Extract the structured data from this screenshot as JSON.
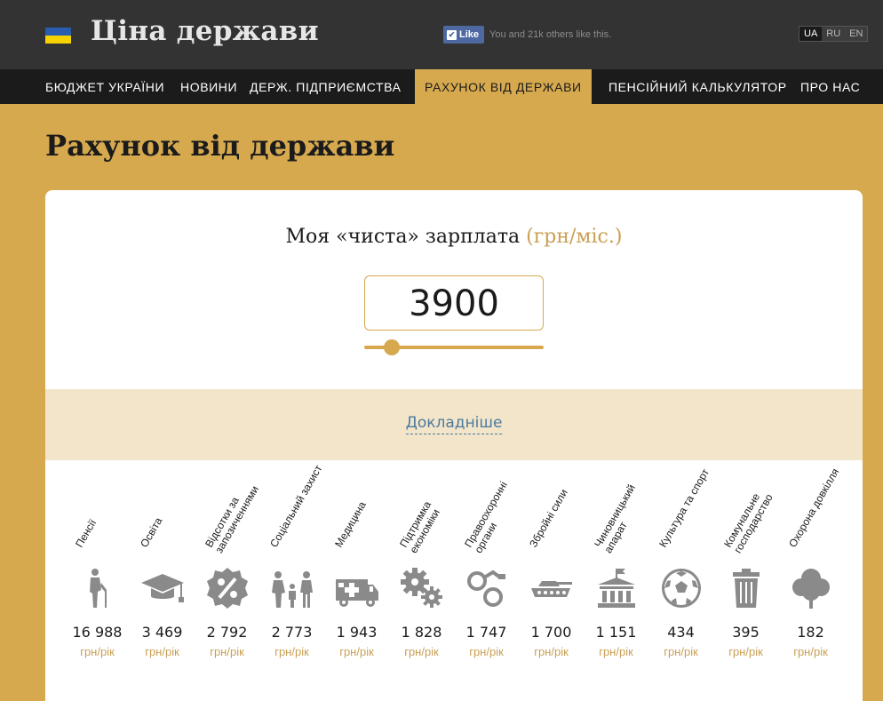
{
  "header": {
    "site_title": "Ціна держави",
    "fb_like": "Like",
    "fb_text": "You and 21k others like this.",
    "languages": [
      "UA",
      "RU",
      "EN"
    ],
    "active_language": "UA"
  },
  "nav": {
    "items": [
      {
        "label": "БЮДЖЕТ УКРАЇНИ"
      },
      {
        "label": "НОВИНИ"
      },
      {
        "label": "ДЕРЖ. ПІДПРИЄМСТВА"
      },
      {
        "label": "РАХУНОК ВІД ДЕРЖАВИ"
      },
      {
        "label": "ПЕНСІЙНИЙ КАЛЬКУЛЯТОР"
      },
      {
        "label": "ПРО НАС"
      }
    ],
    "active": "РАХУНОК ВІД ДЕРЖАВИ"
  },
  "page": {
    "title": "Рахунок від держави"
  },
  "calculator": {
    "label": "Моя «чиста» зарплата",
    "unit": "(грн/міс.)",
    "salary_value": "3900",
    "slider_fraction": 0.12,
    "details_link": "Докладніше"
  },
  "categories": [
    {
      "label": "Пенсії",
      "icon": "pensioner-icon",
      "value": "16 988",
      "unit": "грн/рік"
    },
    {
      "label": "Освіта",
      "icon": "graduation-cap-icon",
      "value": "3 469",
      "unit": "грн/рік"
    },
    {
      "label": "Відсотки за запозиченнями",
      "icon": "percent-badge-icon",
      "value": "2 792",
      "unit": "грн/рік"
    },
    {
      "label": "Соціальний захист",
      "icon": "family-icon",
      "value": "2 773",
      "unit": "грн/рік"
    },
    {
      "label": "Медицина",
      "icon": "ambulance-icon",
      "value": "1 943",
      "unit": "грн/рік"
    },
    {
      "label": "Підтримка економіки",
      "icon": "gears-icon",
      "value": "1 828",
      "unit": "грн/рік"
    },
    {
      "label": "Правоохоронні органи",
      "icon": "handcuffs-icon",
      "value": "1 747",
      "unit": "грн/рік"
    },
    {
      "label": "Збройні сили",
      "icon": "tank-icon",
      "value": "1 700",
      "unit": "грн/рік"
    },
    {
      "label": "Чиновницький апарат",
      "icon": "government-building-icon",
      "value": "1 151",
      "unit": "грн/рік"
    },
    {
      "label": "Культура та спорт",
      "icon": "soccer-ball-icon",
      "value": "434",
      "unit": "грн/рік"
    },
    {
      "label": "Комунальне господарство",
      "icon": "trash-can-icon",
      "value": "395",
      "unit": "грн/рік"
    },
    {
      "label": "Охорона довкілля",
      "icon": "tree-icon",
      "value": "182",
      "unit": "грн/рік"
    }
  ],
  "colors": {
    "accent": "#d6a94f",
    "header_bg": "#333333",
    "nav_bg": "#1b1b1b",
    "icon_gray": "#8a8a8a",
    "link": "#4b7a9e"
  }
}
